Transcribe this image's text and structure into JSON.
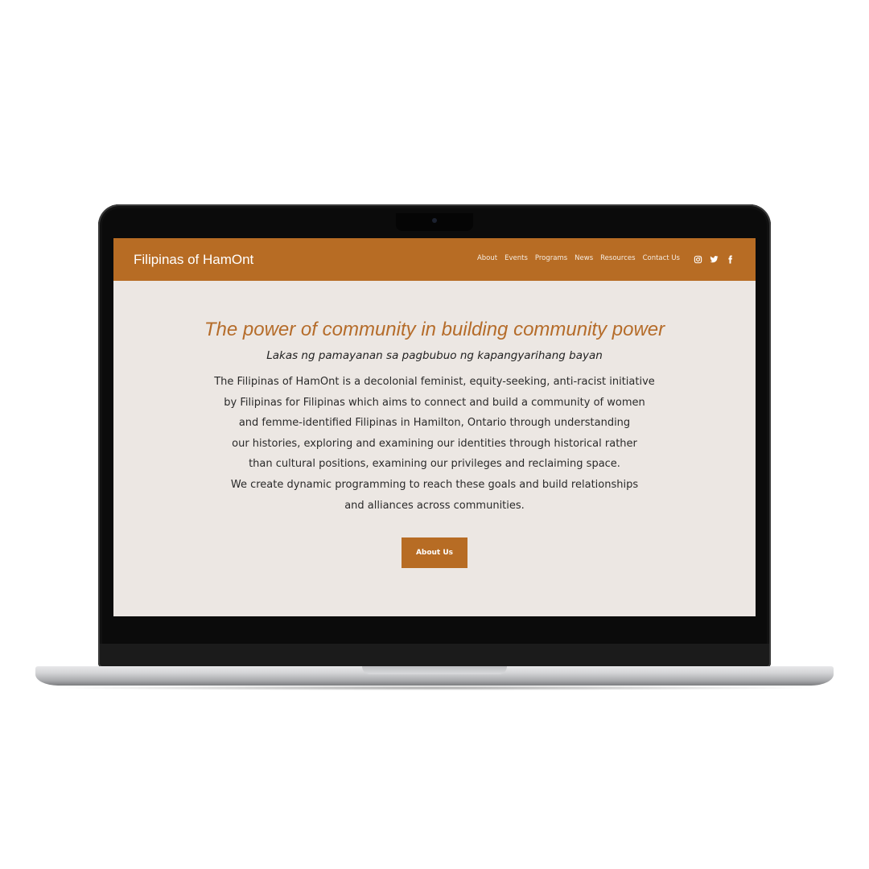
{
  "colors": {
    "accent": "#b76c24",
    "hero_title": "#b56c2a",
    "page_background": "#ece7e3"
  },
  "header": {
    "site_title": "Filipinas of HamOnt",
    "nav": [
      "About",
      "Events",
      "Programs",
      "News",
      "Resources",
      "Contact Us"
    ],
    "social_icons": [
      "instagram-icon",
      "twitter-icon",
      "facebook-icon"
    ]
  },
  "hero": {
    "title": "The power of community in building community power",
    "subtitle": "Lakas ng pamayanan sa pagbubuo ng kapangyarihang bayan",
    "body_lines": [
      "The Filipinas of HamOnt is a decolonial feminist, equity-seeking, anti-racist initiative",
      "by Filipinas for Filipinas which aims  to connect and build a community of women",
      "and femme-identified Filipinas in Hamilton, Ontario through understanding",
      "our histories, exploring and examining our identities through historical rather",
      "than cultural positions, examining our privileges and reclaiming space.",
      "We create dynamic programming to reach these goals and build relationships",
      "and alliances across communities."
    ],
    "button_label": "About Us"
  }
}
